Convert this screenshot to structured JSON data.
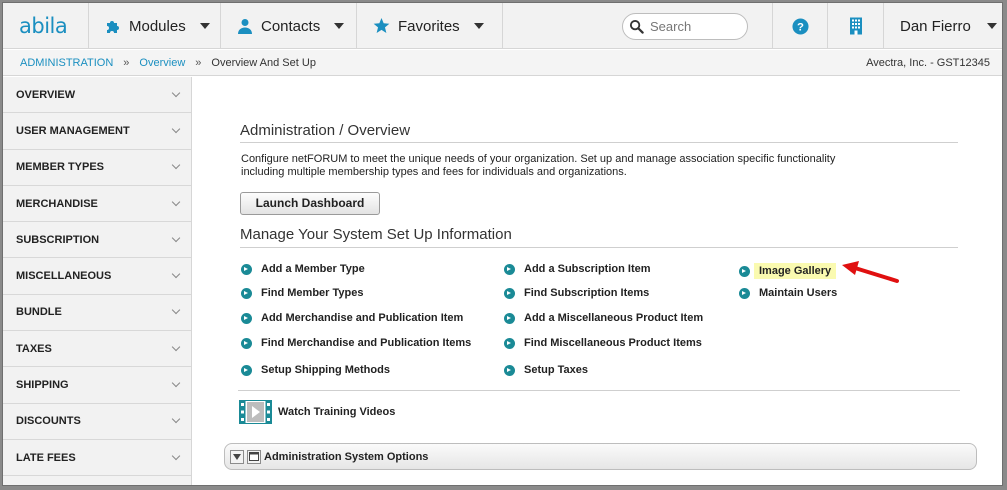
{
  "topbar": {
    "logo": "abila",
    "modules_label": "Modules",
    "contacts_label": "Contacts",
    "favorites_label": "Favorites",
    "search_placeholder": "Search",
    "user_name": "Dan Fierro"
  },
  "breadcrumb": {
    "items": [
      "ADMINISTRATION",
      "Overview",
      "Overview And Set Up"
    ],
    "separator": "»",
    "org_label": "Avectra, Inc. - GST12345"
  },
  "sidebar": {
    "items": [
      {
        "label": "OVERVIEW"
      },
      {
        "label": "USER MANAGEMENT"
      },
      {
        "label": "MEMBER TYPES"
      },
      {
        "label": "MERCHANDISE"
      },
      {
        "label": "SUBSCRIPTION"
      },
      {
        "label": "MISCELLANEOUS"
      },
      {
        "label": "BUNDLE"
      },
      {
        "label": "TAXES"
      },
      {
        "label": "SHIPPING"
      },
      {
        "label": "DISCOUNTS"
      },
      {
        "label": "LATE FEES"
      }
    ]
  },
  "main": {
    "title": "Administration / Overview",
    "description": "Configure netFORUM to meet the unique needs of your organization. Set up and manage association specific functionality including multiple membership types and fees for individuals and organizations.",
    "launch_button": "Launch Dashboard",
    "section_title": "Manage Your System Set Up Information",
    "links": {
      "col1": [
        "Add a Member Type",
        "Find Member Types",
        "Add Merchandise and Publication Item",
        "Find Merchandise and Publication Items",
        "Setup Shipping Methods"
      ],
      "col2": [
        "Add a Subscription Item",
        "Find Subscription Items",
        "Add a Miscellaneous Product Item",
        "Find Miscellaneous Product Items",
        "Setup Taxes"
      ],
      "col3": [
        "Image Gallery",
        "Maintain Users"
      ]
    },
    "training_label": "Watch Training Videos",
    "options_label": "Administration System Options"
  },
  "colors": {
    "brand": "#1b8fc0",
    "link_dot": "#1a8a96",
    "highlight": "#fafab0",
    "annotation_arrow": "#e01010"
  },
  "icons": [
    "puzzle-icon",
    "person-icon",
    "star-icon",
    "search-icon",
    "help-icon",
    "building-icon",
    "chevron-down-icon",
    "link-arrow-icon",
    "film-icon",
    "collapse-icon",
    "window-icon",
    "annotation-arrow"
  ]
}
